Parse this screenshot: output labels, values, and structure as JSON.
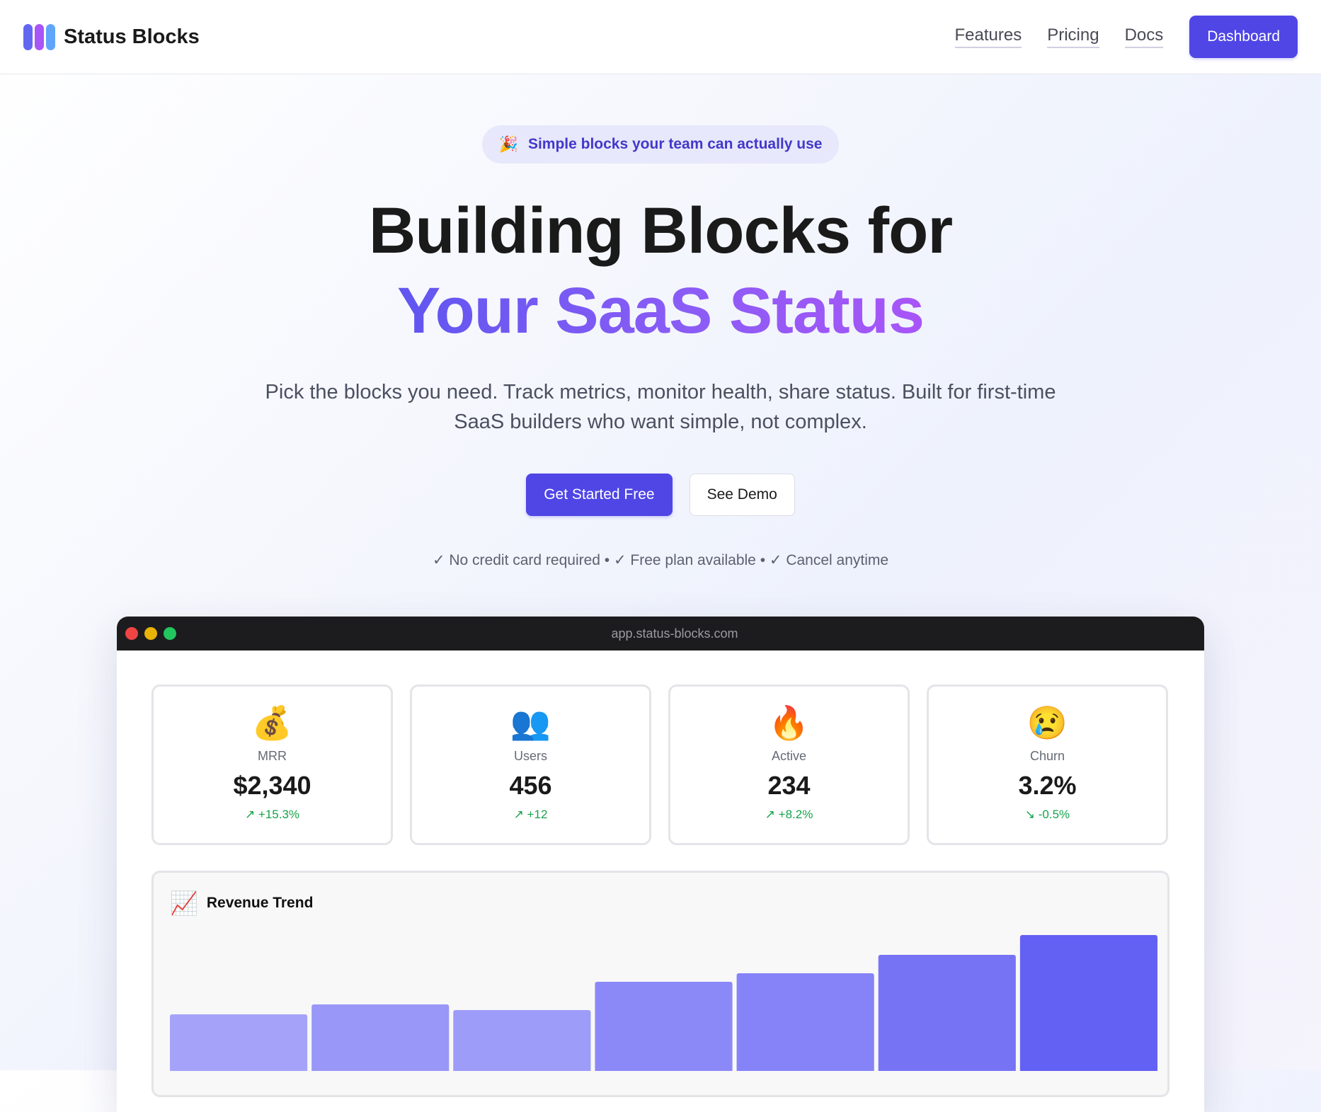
{
  "nav": {
    "brand": "Status Blocks",
    "logo_colors": [
      "#6366f1",
      "#a855f7",
      "#60a5fa"
    ],
    "links": [
      "Features",
      "Pricing",
      "Docs"
    ],
    "dashboard_button": "Dashboard"
  },
  "hero": {
    "pill_icon": "🎉",
    "pill_text": "Simple blocks your team can actually use",
    "title_line1": "Building Blocks for",
    "title_line2": "Your SaaS Status",
    "subtitle": "Pick the blocks you need. Track metrics, monitor health, share status. Built for first-time SaaS builders who want simple, not complex.",
    "cta_primary": "Get Started Free",
    "cta_secondary": "See Demo",
    "trust_line": "✓ No credit card required • ✓ Free plan available • ✓ Cancel anytime"
  },
  "app": {
    "url": "app.status-blocks.com",
    "window_dot_colors": [
      "#ef4444",
      "#eab308",
      "#22c55e"
    ],
    "metrics": [
      {
        "icon": "💰",
        "label": "MRR",
        "value": "$2,340",
        "change": "↗ +15.3%"
      },
      {
        "icon": "👥",
        "label": "Users",
        "value": "456",
        "change": "↗ +12"
      },
      {
        "icon": "🔥",
        "label": "Active",
        "value": "234",
        "change": "↗ +8.2%"
      },
      {
        "icon": "😢",
        "label": "Churn",
        "value": "3.2%",
        "change": "↘ -0.5%"
      }
    ],
    "chart_icon": "📈",
    "chart_title": "Revenue Trend"
  },
  "chart_data": {
    "type": "bar",
    "title": "Revenue Trend",
    "categories": [
      "",
      "",
      "",
      "",
      "",
      "",
      ""
    ],
    "values": [
      40,
      47,
      43,
      63,
      69,
      82,
      96
    ],
    "ylim": [
      0,
      100
    ],
    "colors": [
      "#a5a3f9",
      "#9998f8",
      "#9d9cf9",
      "#8b89f7",
      "#8583f7",
      "#7773f5",
      "#6361f3"
    ],
    "grid": false
  }
}
